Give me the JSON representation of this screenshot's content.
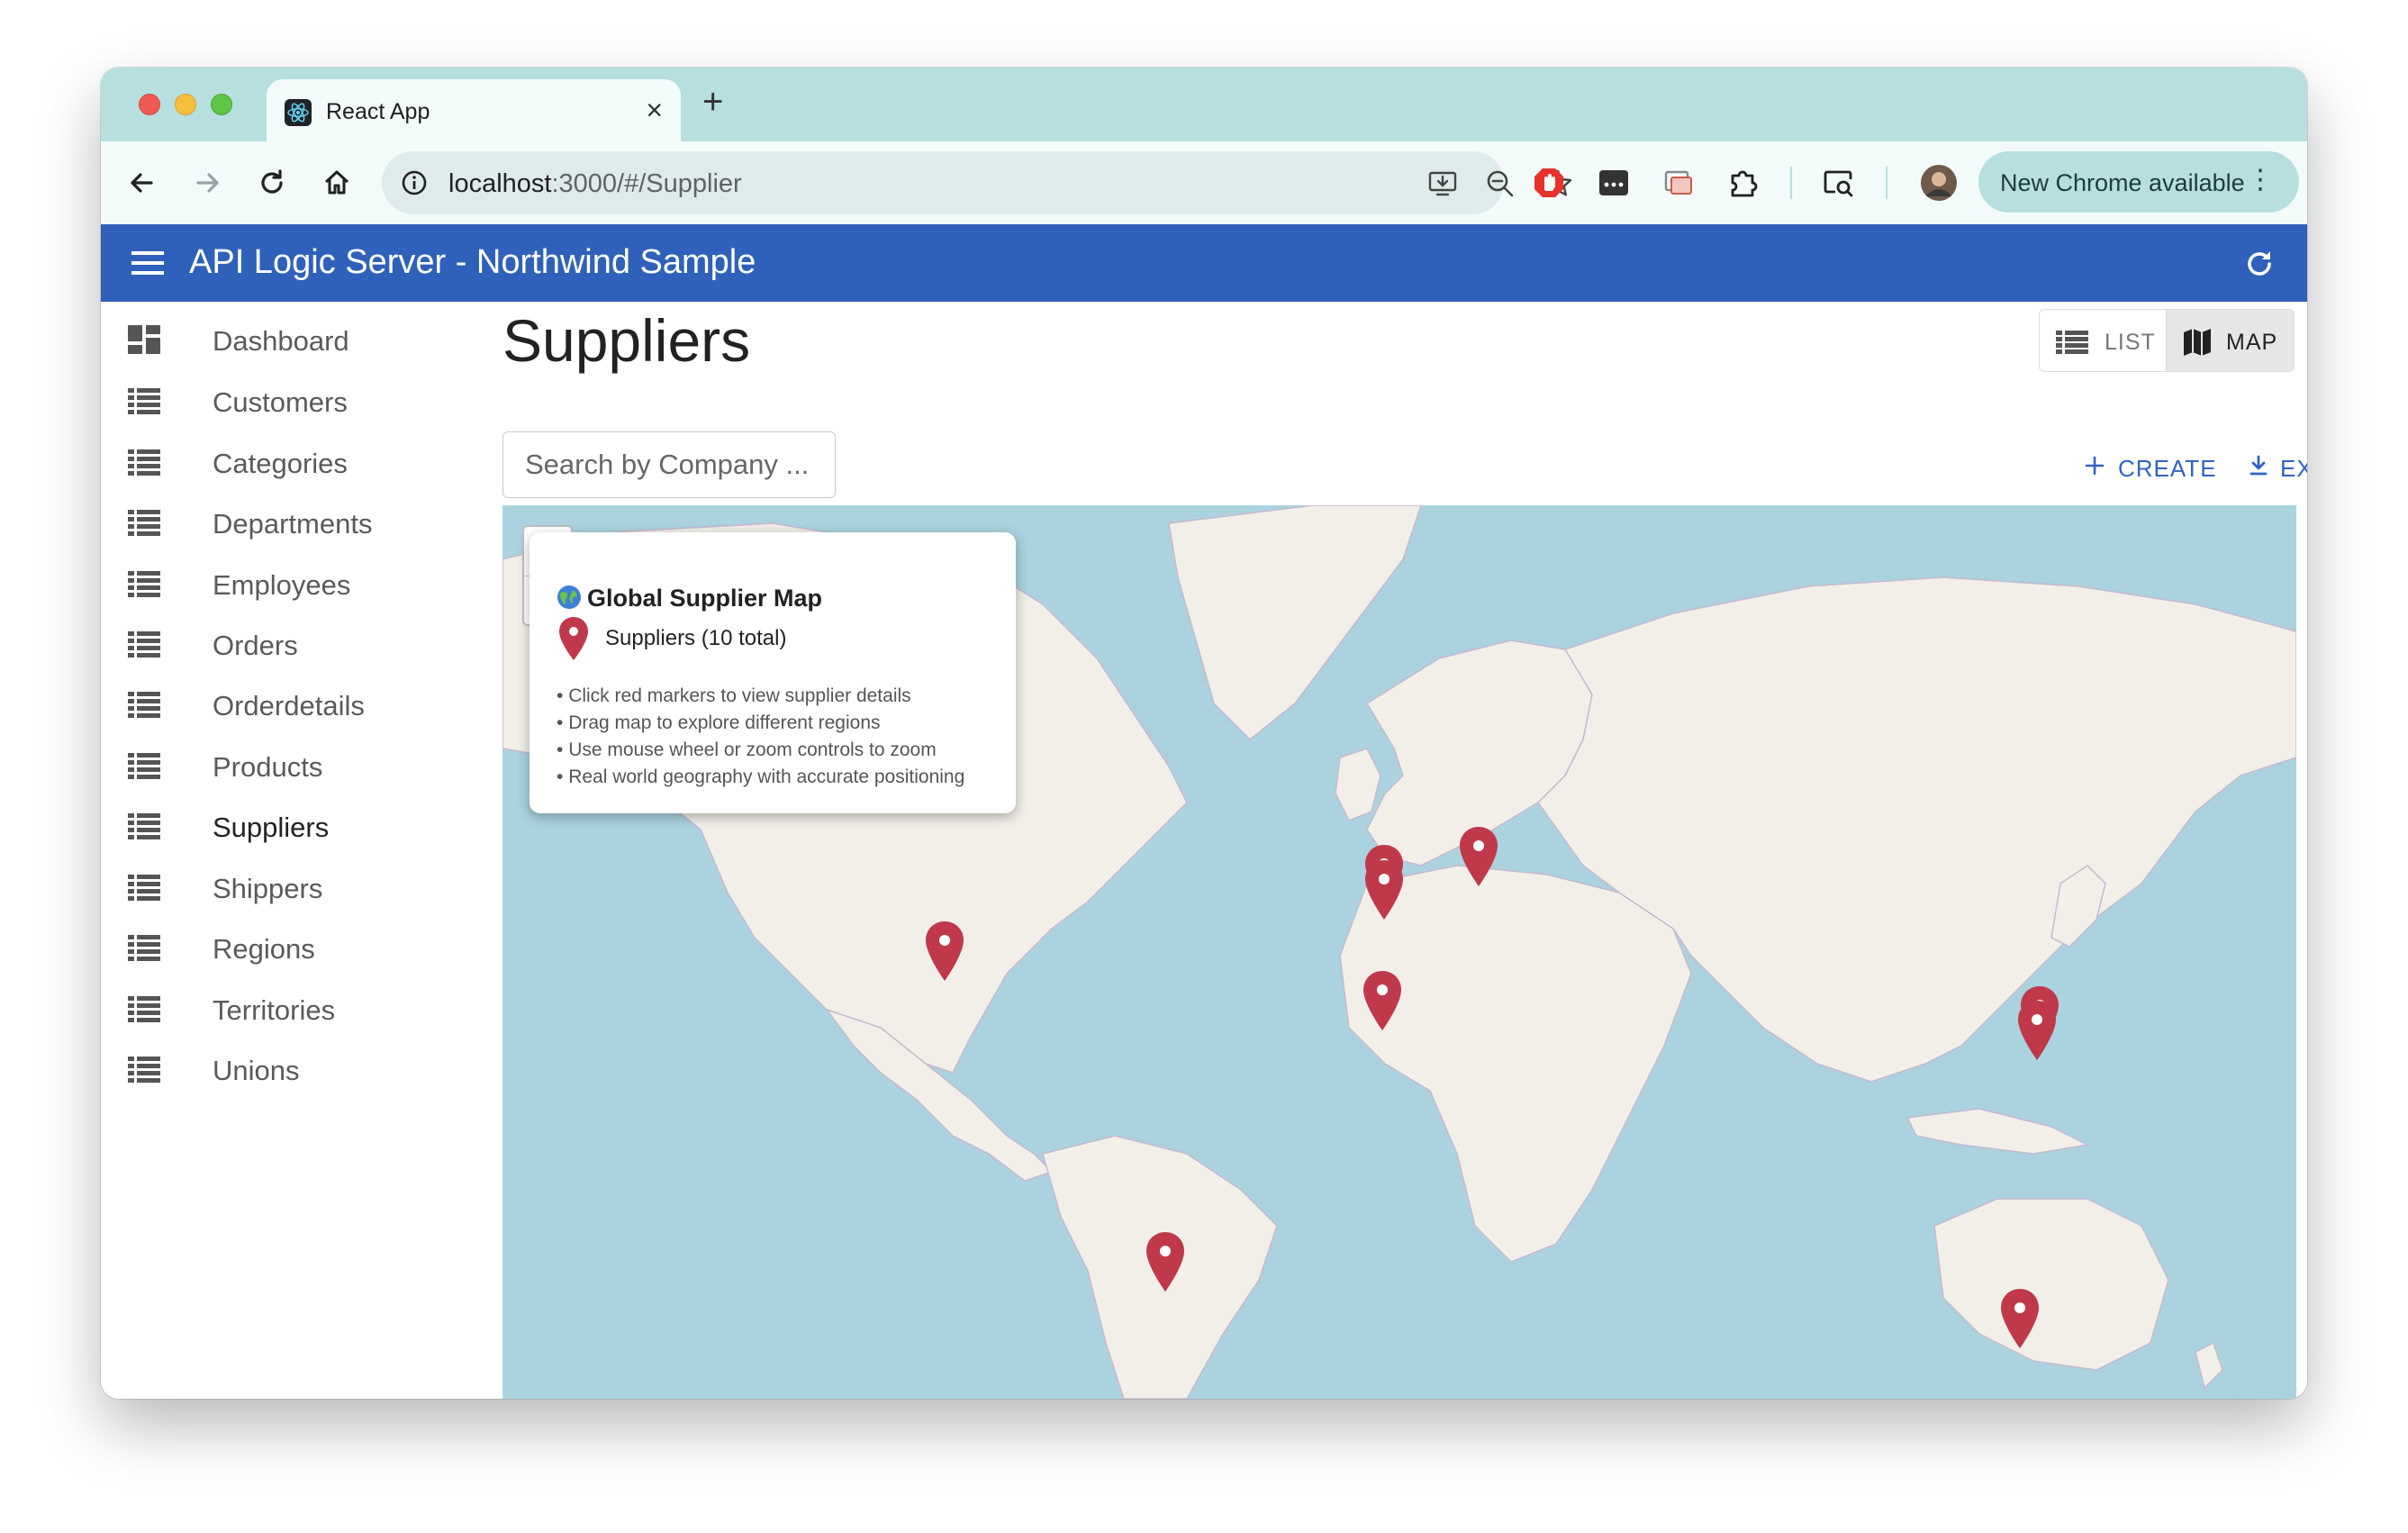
{
  "browser": {
    "tab_title": "React App",
    "url_host": "localhost",
    "url_path": ":3000/#/Supplier",
    "update_button": "New Chrome available"
  },
  "app": {
    "title": "API Logic Server - Northwind Sample",
    "nav": [
      {
        "label": "Dashboard",
        "icon": "dashboard-icon"
      },
      {
        "label": "Customers",
        "icon": "list-icon"
      },
      {
        "label": "Categories",
        "icon": "list-icon"
      },
      {
        "label": "Departments",
        "icon": "list-icon"
      },
      {
        "label": "Employees",
        "icon": "list-icon"
      },
      {
        "label": "Orders",
        "icon": "list-icon"
      },
      {
        "label": "Orderdetails",
        "icon": "list-icon"
      },
      {
        "label": "Products",
        "icon": "list-icon"
      },
      {
        "label": "Suppliers",
        "icon": "list-icon",
        "active": true
      },
      {
        "label": "Shippers",
        "icon": "list-icon"
      },
      {
        "label": "Regions",
        "icon": "list-icon"
      },
      {
        "label": "Territories",
        "icon": "list-icon"
      },
      {
        "label": "Unions",
        "icon": "list-icon"
      }
    ]
  },
  "main": {
    "page_title": "Suppliers",
    "view_toggle": {
      "list": "LIST",
      "map": "MAP",
      "selected": "map"
    },
    "search_placeholder": "Search by Company ...",
    "actions": {
      "create": "CREATE",
      "export": "EXPORT"
    }
  },
  "map": {
    "legend": {
      "title": "Global Supplier Map",
      "count_label": "Suppliers (10 total)",
      "tips": [
        "Click red markers to view supplier details",
        "Drag map to explore different regions",
        "Use mouse wheel or zoom controls to zoom",
        "Real world geography with accurate positioning"
      ]
    },
    "marker_count": 10,
    "colors": {
      "water": "#aad3df",
      "land": "#f2efe9",
      "marker": "#c0394b",
      "appbar": "#3061ba"
    }
  }
}
